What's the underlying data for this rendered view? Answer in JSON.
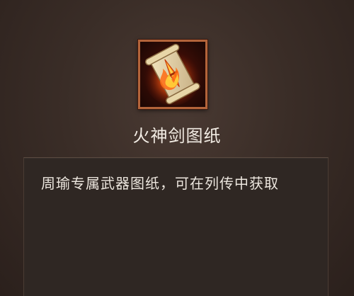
{
  "item": {
    "name": "火神剑图纸",
    "icon": "blueprint-scroll-icon",
    "frame_color": "#b3643a"
  },
  "description": {
    "text": "周瑜专属武器图纸，可在列传中获取"
  }
}
